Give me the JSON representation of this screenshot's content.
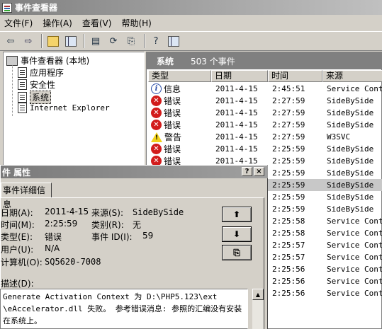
{
  "window": {
    "title": "事件查看器"
  },
  "menu": [
    "文件(F)",
    "操作(A)",
    "查看(V)",
    "帮助(H)"
  ],
  "tree": {
    "root": "事件查看器 (本地)",
    "items": [
      "应用程序",
      "安全性",
      "系统",
      "Internet Explorer"
    ]
  },
  "list": {
    "title": "系统",
    "count": "503 个事件",
    "columns": [
      "类型",
      "日期",
      "时间",
      "来源"
    ],
    "rows": [
      {
        "type": "信息",
        "kind": "info",
        "date": "2011-4-15",
        "time": "2:45:51",
        "source": "Service Control"
      },
      {
        "type": "错误",
        "kind": "error",
        "date": "2011-4-15",
        "time": "2:27:59",
        "source": "SideBySide"
      },
      {
        "type": "错误",
        "kind": "error",
        "date": "2011-4-15",
        "time": "2:27:59",
        "source": "SideBySide"
      },
      {
        "type": "错误",
        "kind": "error",
        "date": "2011-4-15",
        "time": "2:27:59",
        "source": "SideBySide"
      },
      {
        "type": "警告",
        "kind": "warning",
        "date": "2011-4-15",
        "time": "2:27:59",
        "source": "W3SVC"
      },
      {
        "type": "错误",
        "kind": "error",
        "date": "2011-4-15",
        "time": "2:25:59",
        "source": "SideBySide"
      },
      {
        "type": "错误",
        "kind": "error",
        "date": "2011-4-15",
        "time": "2:25:59",
        "source": "SideBySide"
      },
      {
        "time": "2:25:59",
        "source": "SideBySide"
      },
      {
        "time": "2:25:59",
        "source": "SideBySide"
      },
      {
        "time": "2:25:59",
        "source": "SideBySide"
      },
      {
        "time": "2:25:59",
        "source": "SideBySide"
      },
      {
        "time": "2:25:58",
        "source": "Service Control"
      },
      {
        "time": "2:25:58",
        "source": "Service Control"
      },
      {
        "time": "2:25:57",
        "source": "Service Control"
      },
      {
        "time": "2:25:57",
        "source": "Service Control"
      },
      {
        "time": "2:25:56",
        "source": "Service Control"
      },
      {
        "time": "2:25:56",
        "source": "Service Control"
      },
      {
        "time": "2:25:56",
        "source": "Service Control"
      }
    ]
  },
  "dialog": {
    "title": "件 属性",
    "tab": "事件详细信息",
    "date_label": "日期(A):",
    "date": "2011-4-15",
    "source_label": "来源(S):",
    "source": "SideBySide",
    "time_label": "时间(M):",
    "time": "2:25:59",
    "category_label": "类别(R):",
    "category": "无",
    "type_label": "类型(E):",
    "type": "错误",
    "event_id_label": "事件 ID(I):",
    "event_id": "59",
    "user_label": "用户(U):",
    "user": "N/A",
    "computer_label": "计算机(O):",
    "computer": "SQ5620-7008",
    "desc_label": "描述(D):",
    "desc_lines": [
      "Generate Activation Context 为 D:\\PHP5.123\\ext",
      "\\eAccelerator.dll 失败。 参考错误消息: 参照的汇编没有安装",
      "在系统上。"
    ],
    "help_btn": "?",
    "close_btn": "×"
  }
}
